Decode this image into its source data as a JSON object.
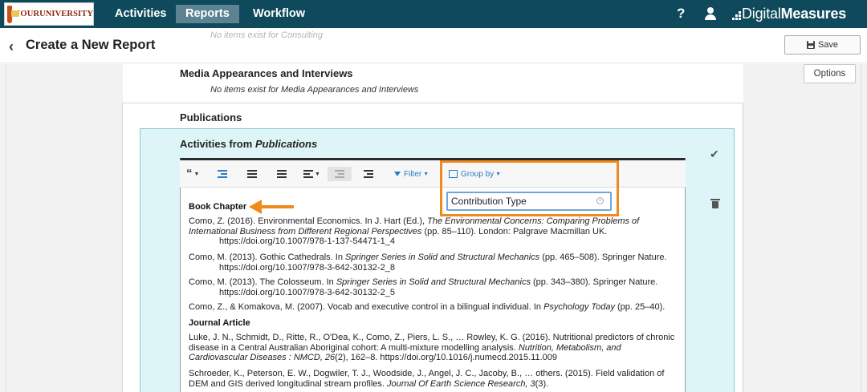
{
  "topbar": {
    "logo_text": "YOURUNIVERSITY",
    "nav": [
      "Activities",
      "Reports",
      "Workflow"
    ],
    "active_nav": "Reports",
    "help_icon": "?",
    "brand": {
      "light": "Digital",
      "bold": "Measures"
    }
  },
  "header": {
    "title": "Create a New Report",
    "ghost_text": "No items exist for Consulting",
    "save_label": "Save",
    "options_label": "Options"
  },
  "sections": {
    "media_heading": "Media Appearances and Interviews",
    "media_empty": "No items exist for Media Appearances and Interviews",
    "publications_heading": "Publications",
    "activities_from": "Activities from",
    "activities_from_source": "Publications"
  },
  "toolbar": {
    "filter_label": "Filter",
    "group_label": "Group by",
    "group_value": "Contribution Type"
  },
  "groups": [
    {
      "title": "Book Chapter",
      "citations": [
        {
          "main": "Como, Z. (2016). Environmental Economics. In J. Hart (Ed.), ",
          "italic": "The Environmental Concerns: Comparing Problems of International Business from Different Regional Perspectives",
          "rest": " (pp. 85–110). London: Palgrave Macmillan UK.",
          "doi": "https://doi.org/10.1007/978-1-137-54471-1_4"
        },
        {
          "main": "Como, M. (2013). Gothic Cathedrals. In ",
          "italic": "Springer Series in Solid and Structural Mechanics",
          "rest": " (pp. 465–508). Springer Nature.",
          "doi": "https://doi.org/10.1007/978-3-642-30132-2_8"
        },
        {
          "main": "Como, M. (2013). The Colosseum. In ",
          "italic": "Springer Series in Solid and Structural Mechanics",
          "rest": " (pp. 343–380). Springer Nature.",
          "doi": "https://doi.org/10.1007/978-3-642-30132-2_5"
        },
        {
          "main": "Como, Z., & Komakova, M. (2007). Vocab and executive control in a bilingual individual. In ",
          "italic": "Psychology Today",
          "rest": " (pp. 25–40).",
          "doi": ""
        }
      ]
    },
    {
      "title": "Journal Article",
      "citations": [
        {
          "main": "Luke, J. N., Schmidt, D., Ritte, R., O'Dea, K., Como, Z., Piers, L. S., … Rowley, K. G. (2016). Nutritional predictors of chronic disease in a Central Australian Aboriginal cohort: A multi-mixture modelling analysis. ",
          "italic": "Nutrition, Metabolism, and Cardiovascular Diseases : NMCD, 26",
          "rest": "(2), 162–8. https://doi.org/10.1016/j.numecd.2015.11.009",
          "doi": ""
        },
        {
          "main": "Schroeder, K., Peterson, E. W., Dogwiler, T. J., Woodside, J., Angel, J. C., Jacoby, B., … others. (2015). Field validation of DEM and GIS derived longitudinal stream profiles. ",
          "italic": "Journal Of Earth Science Research, 3",
          "rest": "(3).",
          "doi": ""
        }
      ]
    }
  ],
  "colors": {
    "nav_bg": "#0f4a5c",
    "highlight": "#f08a1c",
    "activity_bg": "#def5f8",
    "link_blue": "#2f7bbf"
  }
}
